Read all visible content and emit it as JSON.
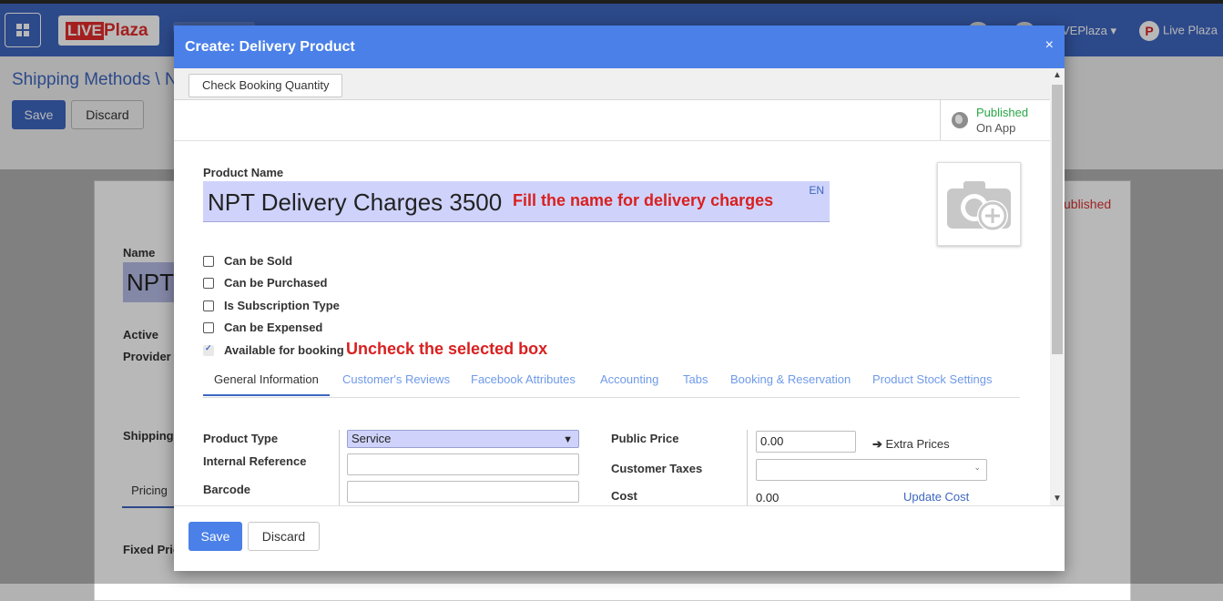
{
  "background": {
    "app_logo_live": "LIVE",
    "app_logo_plaza": "Plaza",
    "user_menu": "VEPlaza ▾",
    "company": "Live Plaza",
    "breadcrumb": "Shipping Methods \\ N",
    "save_label": "Save",
    "discard_label": "Discard",
    "name_label": "Name",
    "name_value": "NPT",
    "active_label": "Active",
    "provider_label": "Provider",
    "shipping_label": "Shipping M",
    "pricing_tab": "Pricing",
    "fixed_price_label": "Fixed Pric",
    "status": "ublished"
  },
  "modal": {
    "title": "Create: Delivery Product",
    "close": "×",
    "check_booking": "Check Booking Quantity",
    "published": "Published",
    "published_sub": "On App",
    "product_name_label": "Product Name",
    "product_name_value": "NPT Delivery Charges 3500",
    "lang": "EN",
    "annotation_name": "Fill the name for delivery charges",
    "annotation_checkbox": "Uncheck the selected box",
    "checkboxes": [
      {
        "label": "Can be Sold",
        "checked": false
      },
      {
        "label": "Can be Purchased",
        "checked": false
      },
      {
        "label": "Is Subscription Type",
        "checked": false
      },
      {
        "label": "Can be Expensed",
        "checked": false
      },
      {
        "label": "Available for booking",
        "checked": true
      }
    ],
    "tabs": [
      "General Information",
      "Customer's Reviews",
      "Facebook Attributes",
      "Accounting",
      "Tabs",
      "Booking & Reservation",
      "Product Stock Settings"
    ],
    "product_type_label": "Product Type",
    "product_type_value": "Service",
    "internal_ref_label": "Internal Reference",
    "barcode_label": "Barcode",
    "public_price_label": "Public Price",
    "public_price_value": "0.00",
    "extra_prices": "Extra Prices",
    "customer_taxes_label": "Customer Taxes",
    "cost_label": "Cost",
    "cost_value": "0.00",
    "update_cost": "Update Cost",
    "save_label": "Save",
    "discard_label": "Discard"
  }
}
